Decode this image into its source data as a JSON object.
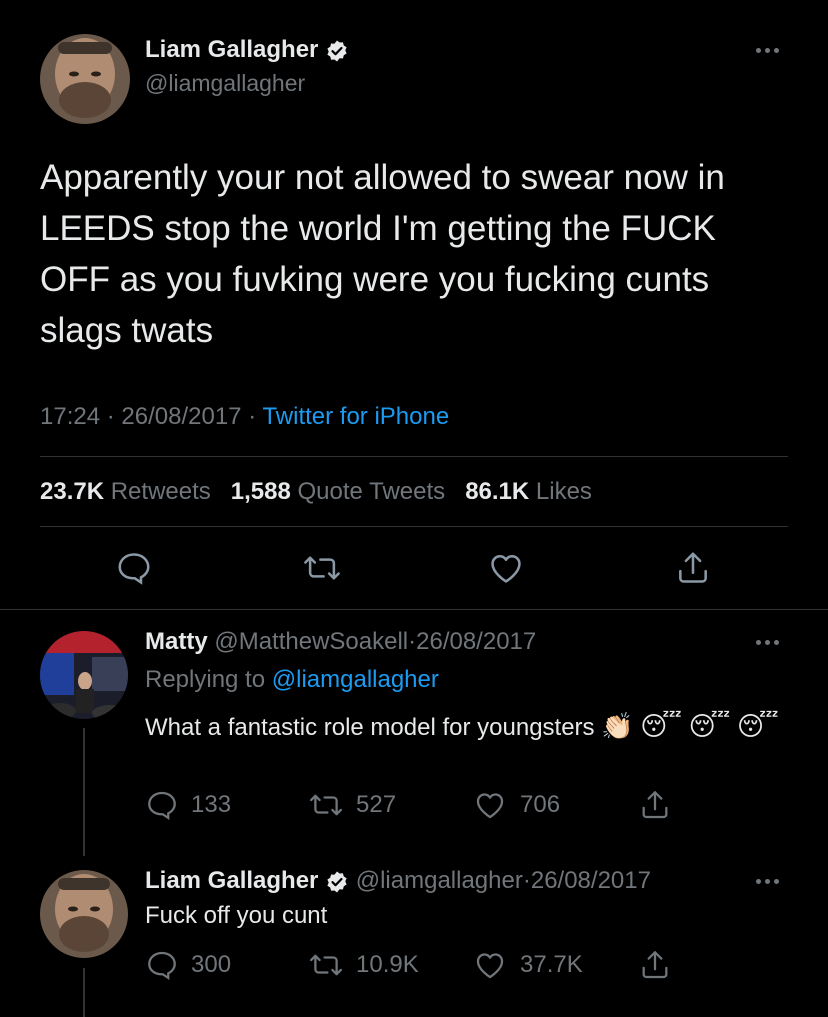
{
  "main_tweet": {
    "author": {
      "name": "Liam Gallagher",
      "handle": "@liamgallagher"
    },
    "text_lines": [
      "Apparently your not allowed to swear now in",
      "LEEDS stop the world I'm getting the FUCK",
      "OFF as you fuvking were you fucking cunts",
      "slags twats"
    ],
    "time": "17:24",
    "date": "26/08/2017",
    "sep": "·",
    "source": "Twitter for iPhone",
    "stats": {
      "retweets_count": "23.7K",
      "retweets_label": "Retweets",
      "quotes_count": "1,588",
      "quotes_label": "Quote Tweets",
      "likes_count": "86.1K",
      "likes_label": "Likes"
    }
  },
  "reply1": {
    "name": "Matty",
    "handle": "@MatthewSoakell",
    "sep": "·",
    "date": "26/08/2017",
    "replying_label": "Replying to",
    "replying_to": "@liamgallagher",
    "text": "What a fantastic role model for youngsters",
    "emojis": [
      "👏🏻",
      "😴",
      "😴",
      "😴"
    ],
    "counts": {
      "reply": "133",
      "retweet": "527",
      "like": "706"
    }
  },
  "reply2": {
    "name": "Liam Gallagher",
    "handle": "@liamgallagher",
    "sep": "·",
    "date": "26/08/2017",
    "text": "Fuck off you cunt",
    "counts": {
      "reply": "300",
      "retweet": "10.9K",
      "like": "37.7K"
    }
  },
  "colors": {
    "background": "#000000",
    "text": "#e7e9ea",
    "muted": "#71767b",
    "link": "#1d9bf0",
    "divider": "#2f3336"
  }
}
